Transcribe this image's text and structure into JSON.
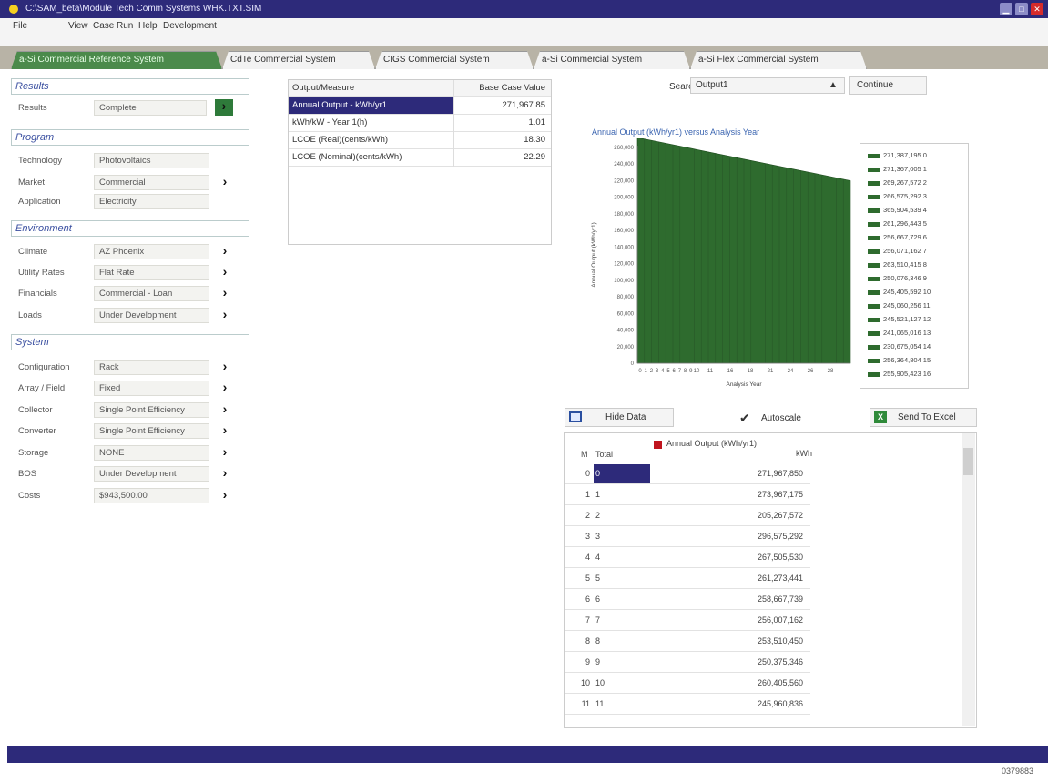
{
  "window": {
    "title": "C:\\SAM_beta\\Module Tech Comm Systems WHK.TXT.SIM"
  },
  "menu": [
    "File",
    "View",
    "Case",
    "Run",
    "Help",
    "Development"
  ],
  "tabs": [
    "a-Si Commercial Reference System",
    "CdTe Commercial System",
    "CIGS Commercial System",
    "a-Si Commercial System",
    "a-Si Flex Commercial System"
  ],
  "left": {
    "results_header": "Results",
    "results_label": "Results",
    "results_value": "Complete",
    "program_header": "Program",
    "technology_label": "Technology",
    "technology_value": "Photovoltaics",
    "market_label": "Market",
    "market_value": "Commercial",
    "application_label": "Application",
    "application_value": "Electricity",
    "environment_header": "Environment",
    "climate_label": "Climate",
    "climate_value": "AZ Phoenix",
    "utility_label": "Utility Rates",
    "utility_value": "Flat Rate",
    "financials_label": "Financials",
    "financials_value": "Commercial - Loan",
    "loads_label": "Loads",
    "loads_value": "Under Development",
    "system_header": "System",
    "configuration_label": "Configuration",
    "configuration_value": "Rack",
    "array_label": "Array / Field",
    "array_value": "Fixed",
    "collector_label": "Collector",
    "collector_value": "Single Point Efficiency",
    "converter_label": "Converter",
    "converter_value": "Single Point Efficiency",
    "storage_label": "Storage",
    "storage_value": "NONE",
    "bos_label": "BOS",
    "bos_value": "Under Development",
    "costs_label": "Costs",
    "costs_value": "$943,500.00"
  },
  "outputs": {
    "header_measure": "Output/Measure",
    "header_value": "Base Case Value",
    "rows": [
      {
        "measure": "Annual Output - kWh/yr1",
        "value": "271,967.85"
      },
      {
        "measure": "kWh/kW - Year 1(h)",
        "value": "1.01"
      },
      {
        "measure": "LCOE (Real)(cents/kWh)",
        "value": "18.30"
      },
      {
        "measure": "LCOE (Nominal)(cents/kWh)",
        "value": "22.29"
      }
    ]
  },
  "search": {
    "label": "Search",
    "value": "Output1",
    "continue_label": "Continue"
  },
  "chart_data": {
    "type": "area",
    "title": "Annual Output (kWh/yr1) versus Analysis Year",
    "xlabel": "Analysis Year",
    "ylabel": "Annual Output (kWh/yr1)",
    "ylim": [
      0,
      260000
    ],
    "yticks": [
      "260,000",
      "240,000",
      "220,000",
      "200,000",
      "180,000",
      "160,000",
      "140,000",
      "120,000",
      "100,000",
      "80,000",
      "60,000",
      "40,000",
      "20,000",
      "0"
    ],
    "xtick_labels": [
      "0",
      "1",
      "2",
      "3",
      "4",
      "5",
      "6",
      "7",
      "8",
      "9",
      "10",
      "11",
      "16",
      "18",
      "21",
      "24",
      "26",
      "28"
    ],
    "x": [
      0,
      30
    ],
    "values": [
      271967,
      220000
    ],
    "legend_entries": [
      "271,387,195 0",
      "271,367,005 1",
      "269,267,572 2",
      "266,575,292 3",
      "365,904,539 4",
      "261,296,443 5",
      "256,667,729 6",
      "256,071,162 7",
      "263,510,415 8",
      "250,076,346 9",
      "245,405,592 10",
      "245,060,256 11",
      "245,521,127 12",
      "241,065,016 13",
      "230,675,054 14",
      "256,364,804 15",
      "255,905,423 16"
    ],
    "legend_position": "right",
    "series_color": "#2e6b2e"
  },
  "table_toolbar": {
    "hide_label": "Hide Data",
    "autoscale_label": "Autoscale",
    "excel_label": "Send To Excel"
  },
  "data_table": {
    "col_m": "M",
    "col_total": "Total",
    "col_value": "Annual Output (kWh/yr1)",
    "col_unit": "kWh",
    "rows": [
      {
        "m": "0",
        "t": "0",
        "v": "271,967,850"
      },
      {
        "m": "1",
        "t": "1",
        "v": "273,967,175"
      },
      {
        "m": "2",
        "t": "2",
        "v": "205,267,572"
      },
      {
        "m": "3",
        "t": "3",
        "v": "296,575,292"
      },
      {
        "m": "4",
        "t": "4",
        "v": "267,505,530"
      },
      {
        "m": "5",
        "t": "5",
        "v": "261,273,441"
      },
      {
        "m": "6",
        "t": "6",
        "v": "258,667,739"
      },
      {
        "m": "7",
        "t": "7",
        "v": "256,007,162"
      },
      {
        "m": "8",
        "t": "8",
        "v": "253,510,450"
      },
      {
        "m": "9",
        "t": "9",
        "v": "250,375,346"
      },
      {
        "m": "10",
        "t": "10",
        "v": "260,405,560"
      },
      {
        "m": "11",
        "t": "11",
        "v": "245,960,836"
      }
    ]
  },
  "image_number": "0379883"
}
